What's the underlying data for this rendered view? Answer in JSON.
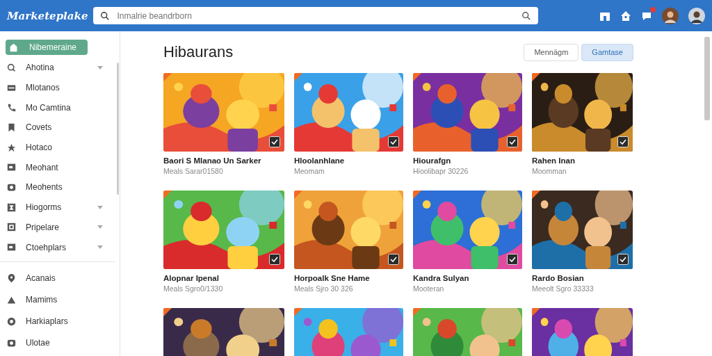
{
  "header": {
    "logo": "Marketeplake",
    "search": {
      "placeholder": "Inmalrie beandrborn"
    },
    "notification": true
  },
  "sidebar": {
    "items": [
      {
        "label": "Nibemeraine",
        "selected": true,
        "expandable": false
      },
      {
        "label": "Ahotina",
        "selected": false,
        "expandable": true
      },
      {
        "label": "Mlotanos",
        "selected": false,
        "expandable": false
      },
      {
        "label": "Mo Camtina",
        "selected": false,
        "expandable": false
      },
      {
        "label": "Covets",
        "selected": false,
        "expandable": false
      },
      {
        "label": "Hotaco",
        "selected": false,
        "expandable": false
      },
      {
        "label": "Meohant",
        "selected": false,
        "expandable": false
      },
      {
        "label": "Meohents",
        "selected": false,
        "expandable": false
      },
      {
        "label": "Hiogorms",
        "selected": false,
        "expandable": true
      },
      {
        "label": "Pripelare",
        "selected": false,
        "expandable": true
      },
      {
        "label": "Ctoehplars",
        "selected": false,
        "expandable": true
      }
    ],
    "bottom_items": [
      {
        "label": "Acanais",
        "selected": false
      },
      {
        "label": "Mamims",
        "selected": false
      },
      {
        "label": "Harkiaplars",
        "selected": false
      },
      {
        "label": "Ulotae",
        "selected": false
      }
    ]
  },
  "main": {
    "title": "Hibaurans",
    "toggle": [
      {
        "label": "Mennägm",
        "selected": false
      },
      {
        "label": "Gamtase",
        "selected": true
      }
    ],
    "cards": [
      {
        "title": "Baori S Mlanao Un Sarker",
        "subtitle": "Meals Sarar01580"
      },
      {
        "title": "Hloolanhlane",
        "subtitle": "Meomam"
      },
      {
        "title": "Hiourafgn",
        "subtitle": "Hioolibapr 30226"
      },
      {
        "title": "Rahen Inan",
        "subtitle": "Moomman"
      },
      {
        "title": "Alopnar Ipenal",
        "subtitle": "Meals Sgro0/1330"
      },
      {
        "title": "Horpoalk Sne Hame",
        "subtitle": "Meals Sjro 30 326"
      },
      {
        "title": "Kandra Sulyan",
        "subtitle": "Mooteran"
      },
      {
        "title": "Rardo Bosian",
        "subtitle": "Meeolt Sgro 33333"
      },
      {
        "kind": "picture"
      },
      {
        "kind": "picture"
      },
      {
        "kind": "picture"
      },
      {
        "kind": "picture"
      }
    ]
  }
}
